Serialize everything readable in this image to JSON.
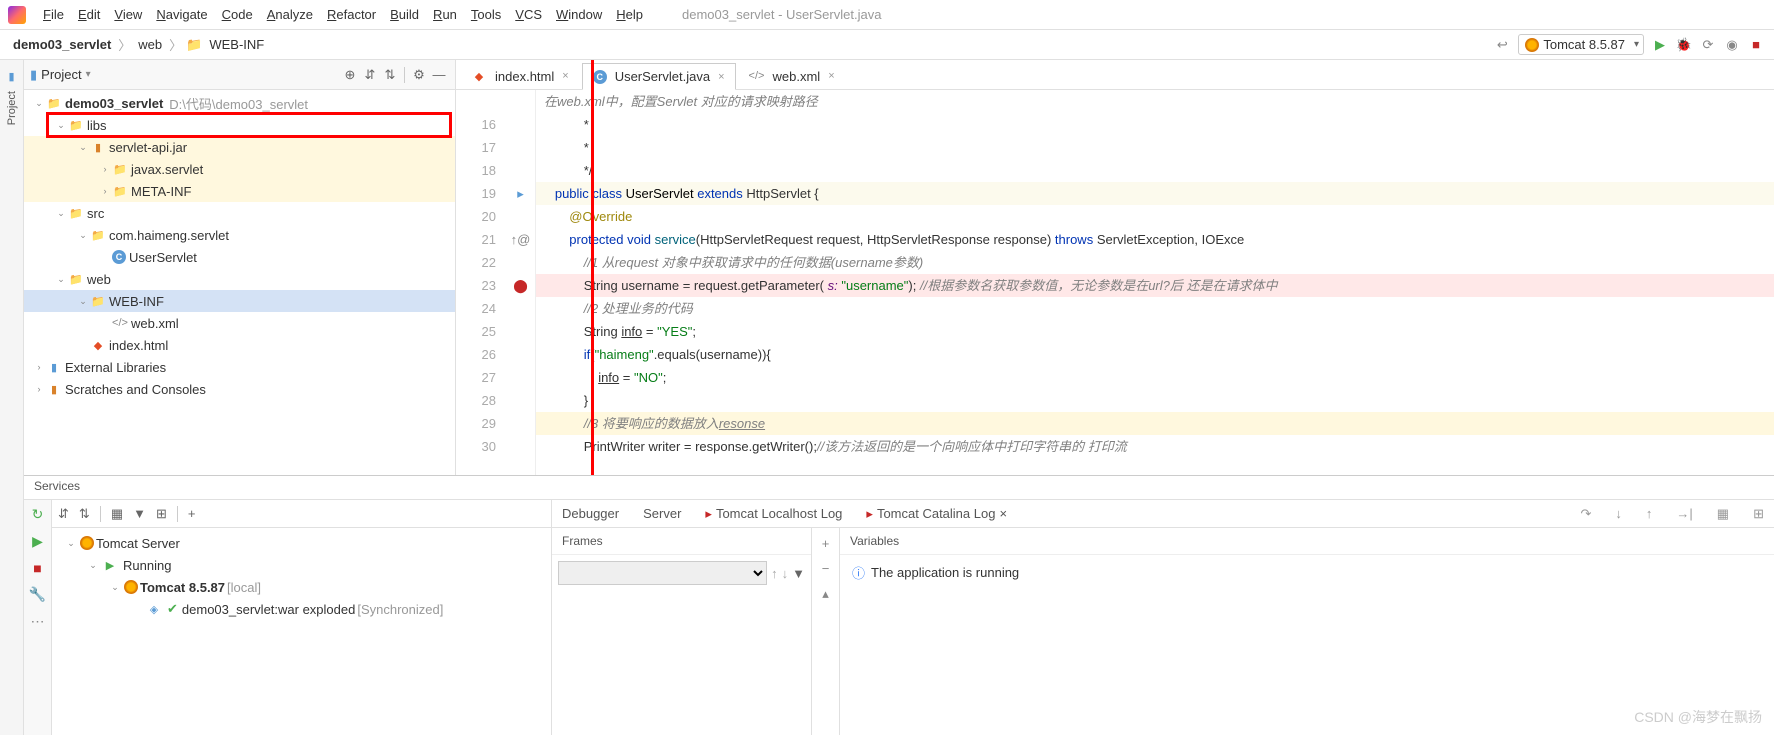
{
  "window_title": "demo03_servlet - UserServlet.java",
  "menu": [
    "File",
    "Edit",
    "View",
    "Navigate",
    "Code",
    "Analyze",
    "Refactor",
    "Build",
    "Run",
    "Tools",
    "VCS",
    "Window",
    "Help"
  ],
  "breadcrumb": [
    "demo03_servlet",
    "web",
    "WEB-INF"
  ],
  "run_config": "Tomcat 8.5.87",
  "project_panel": {
    "title": "Project",
    "root": {
      "name": "demo03_servlet",
      "path": "D:\\代码\\demo03_servlet"
    },
    "tree": [
      {
        "d": 1,
        "exp": true,
        "ico": "folder",
        "name": "libs",
        "hl": false
      },
      {
        "d": 2,
        "exp": true,
        "ico": "jar",
        "name": "servlet-api.jar",
        "hl": true
      },
      {
        "d": 3,
        "exp": false,
        "ico": "folder",
        "name": "javax.servlet",
        "hl": true
      },
      {
        "d": 3,
        "exp": false,
        "ico": "folder",
        "name": "META-INF",
        "hl": true
      },
      {
        "d": 1,
        "exp": true,
        "ico": "folder-blue",
        "name": "src",
        "hl": false
      },
      {
        "d": 2,
        "exp": true,
        "ico": "folder",
        "name": "com.haimeng.servlet",
        "hl": false
      },
      {
        "d": 3,
        "exp": null,
        "ico": "java",
        "name": "UserServlet",
        "hl": false
      },
      {
        "d": 1,
        "exp": true,
        "ico": "folder-blue",
        "name": "web",
        "hl": false
      },
      {
        "d": 2,
        "exp": true,
        "ico": "folder",
        "name": "WEB-INF",
        "sel": true
      },
      {
        "d": 3,
        "exp": null,
        "ico": "xml",
        "name": "web.xml",
        "hl": false
      },
      {
        "d": 2,
        "exp": null,
        "ico": "html",
        "name": "index.html",
        "hl": false
      }
    ],
    "ext_libs": "External Libraries",
    "scratches": "Scratches and Consoles"
  },
  "editor_tabs": [
    {
      "ico": "html",
      "label": "index.html",
      "active": false
    },
    {
      "ico": "java",
      "label": "UserServlet.java",
      "active": true
    },
    {
      "ico": "xml",
      "label": "web.xml",
      "active": false
    }
  ],
  "line_start": 16,
  "code_lines": [
    {
      "n": 16,
      "cls": "",
      "html": "           *"
    },
    {
      "n": 17,
      "cls": "",
      "html": "           *"
    },
    {
      "n": 18,
      "cls": "",
      "html": "           */"
    },
    {
      "n": 19,
      "cls": "hl1",
      "html": "   <span class='kw'>public class</span> <span class='cls-name'>UserServlet</span> <span class='kw'>extends</span> HttpServlet {"
    },
    {
      "n": 20,
      "cls": "",
      "html": "       <span class='ann'>@Override</span>"
    },
    {
      "n": 21,
      "cls": "",
      "html": "       <span class='kw'>protected void</span> <span class='mtd'>service</span>(HttpServletRequest request, HttpServletResponse response) <span class='kw'>throws</span> ServletException, IOExce"
    },
    {
      "n": 22,
      "cls": "",
      "html": "           <span class='cmt'>//1 从request 对象中获取请求中的任何数据(username参数)</span>"
    },
    {
      "n": 23,
      "cls": "hl3",
      "html": "           String username = request.getParameter( <span class='param'>s:</span> <span class='str'>\"username\"</span>); <span class='cmt'>//根据参数名获取参数值，无论参数是在url?后 还是在请求体中</span>"
    },
    {
      "n": 24,
      "cls": "",
      "html": "           <span class='cmt'>//2 处理业务的代码</span>"
    },
    {
      "n": 25,
      "cls": "",
      "html": "           String <u>info</u> = <span class='str'>\"YES\"</span>;"
    },
    {
      "n": 26,
      "cls": "",
      "html": "           <span class='kw'>if</span>(<span class='str'>\"haimeng\"</span>.equals(username)){"
    },
    {
      "n": 27,
      "cls": "",
      "html": "               <u>info</u> = <span class='str'>\"NO\"</span>;"
    },
    {
      "n": 28,
      "cls": "",
      "html": "           }"
    },
    {
      "n": 29,
      "cls": "hl2",
      "html": "           <span class='cmt'>//3 将要响应的数据放入<u>resonse</u></span>"
    },
    {
      "n": 30,
      "cls": "",
      "html": "           PrintWriter writer = response.getWriter();<span class='cmt'>//该方法返回的是一个向响应体中打印字符串的 打印流</span>"
    }
  ],
  "comment_header": "在web.xml中，配置Servlet 对应的请求映射路径",
  "services": {
    "title": "Services",
    "tree": [
      {
        "d": 0,
        "exp": true,
        "ico": "tomcat",
        "name": "Tomcat Server"
      },
      {
        "d": 1,
        "exp": true,
        "ico": "run",
        "name": "Running"
      },
      {
        "d": 2,
        "exp": true,
        "ico": "tomcat",
        "name": "Tomcat 8.5.87",
        "suffix": "[local]",
        "bold": true
      },
      {
        "d": 3,
        "exp": null,
        "ico": "artifact",
        "name": "demo03_servlet:war exploded",
        "suffix": "[Synchronized]"
      }
    ],
    "debugger_tabs": [
      "Debugger",
      "Server",
      "Tomcat Localhost Log",
      "Tomcat Catalina Log"
    ],
    "frames_label": "Frames",
    "vars_label": "Variables",
    "status_msg": "The application is running"
  },
  "watermark": "CSDN @海梦在飘扬"
}
